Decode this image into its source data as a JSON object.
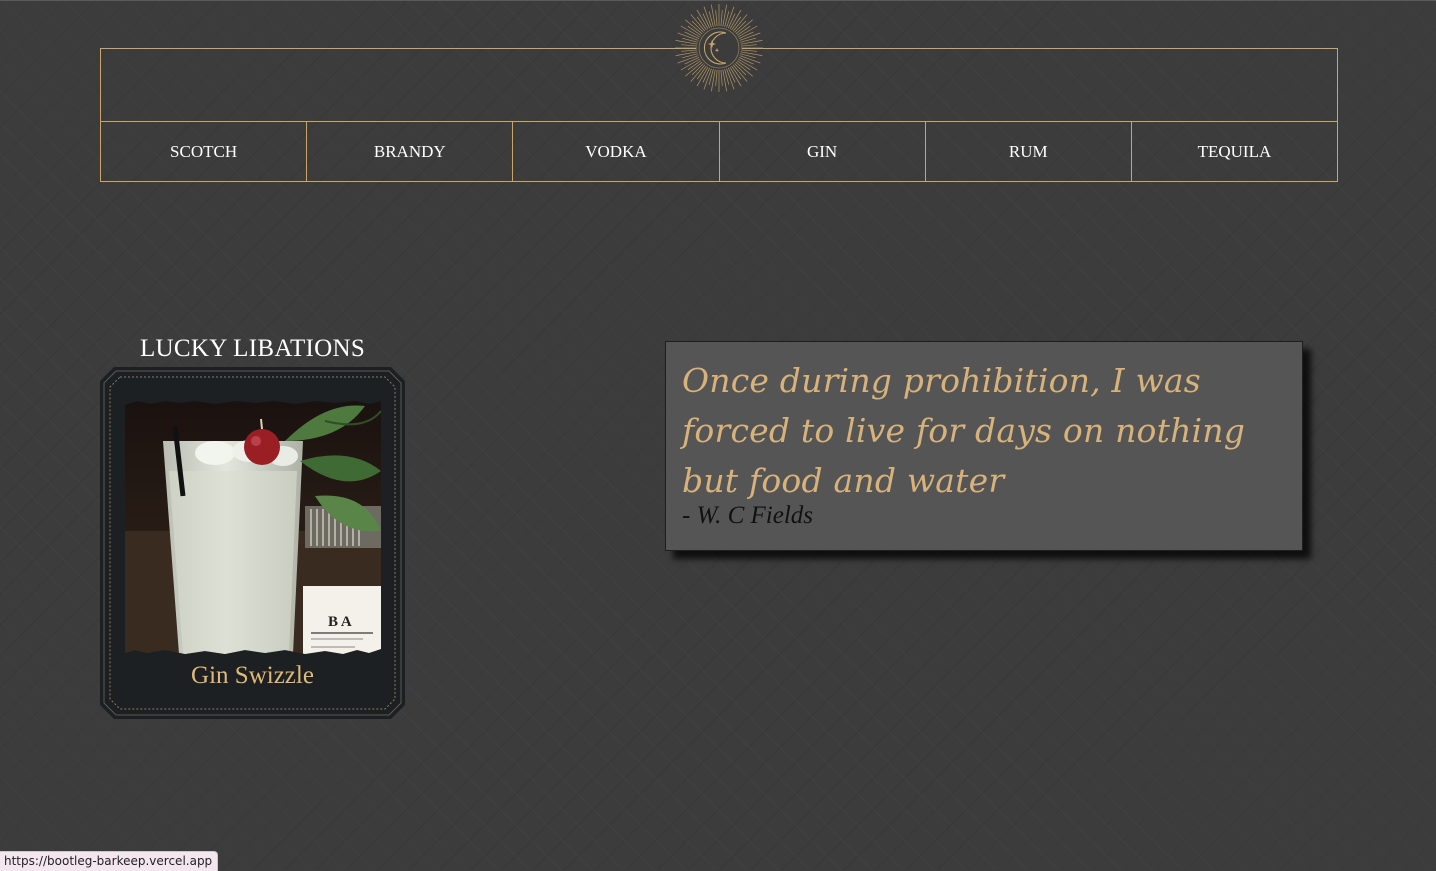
{
  "nav": {
    "items": [
      {
        "label": "SCOTCH"
      },
      {
        "label": "BRANDY"
      },
      {
        "label": "VODKA"
      },
      {
        "label": "GIN"
      },
      {
        "label": "RUM"
      },
      {
        "label": "TEQUILA"
      }
    ]
  },
  "featured": {
    "title": "LUCKY LIBATIONS",
    "card": {
      "name": "Gin Swizzle",
      "image_icon": "cocktail-photo"
    }
  },
  "quote": {
    "text": "Once during prohibition, I was forced to live for days on nothing but food and water",
    "author": "- W. C Fields"
  },
  "status_bar": {
    "url": "https://bootleg-barkeep.vercel.app"
  },
  "colors": {
    "accent_gold": "#c9a76b",
    "quote_text": "#d7b27a",
    "background": "#3c3c3c",
    "card_bg": "#1c2022"
  },
  "logo_icon": "sun-moon-icon"
}
